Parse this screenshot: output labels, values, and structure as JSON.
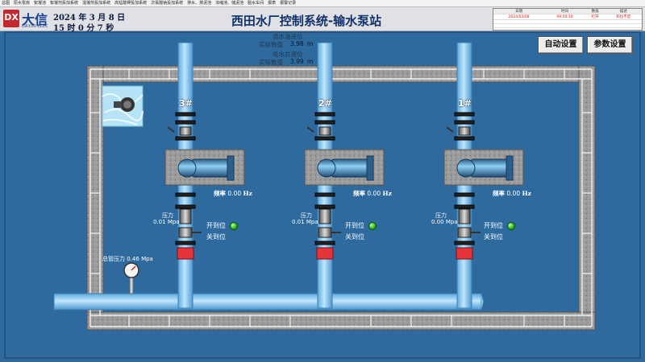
{
  "menu": [
    "总图",
    "原水泵房",
    "絮凝池",
    "絮凝剂投加系统",
    "混凝剂投加系统",
    "高锰酸钾投加系统",
    "次氯酸钠投加系统",
    "排水、排泥池",
    "浓缩池、储泥池",
    "脱水车间",
    "报表",
    "报警记录"
  ],
  "header": {
    "logo_mark": "DX",
    "logo_name": "大信",
    "logo_sub": "DAXIN-ELEC",
    "date_line": "2024 年  3  月  8  日",
    "time_line": "15  时  0  分 7  秒",
    "title": "西田水厂控制系统-输水泵站"
  },
  "alarm": {
    "headers": [
      "日期",
      "时间",
      "数值",
      "描述"
    ],
    "row": [
      "2024/03/08",
      "09:50:10",
      "打开",
      "料位不足"
    ]
  },
  "buttons": {
    "auto": "自动设置",
    "params": "参数设置"
  },
  "levels": {
    "clear_label": "清水池液位",
    "clear_value_label": "实际数值",
    "clear_value": "3.98",
    "clear_unit": "m",
    "suction_label": "吸水井液位",
    "suction_value_label": "实际数值",
    "suction_value": "3.99",
    "suction_unit": "m"
  },
  "pumps": [
    {
      "num": "3#",
      "freq_label": "频率",
      "freq": "0.00",
      "freq_unit": "Hz",
      "press_label": "压力",
      "press": "0.01",
      "press_unit": "Mpa",
      "open_label": "开到位",
      "close_label": "关到位"
    },
    {
      "num": "2#",
      "freq_label": "频率",
      "freq": "0.00",
      "freq_unit": "Hz",
      "press_label": "压力",
      "press": "0.01",
      "press_unit": "Mpa",
      "open_label": "开到位",
      "close_label": "关到位"
    },
    {
      "num": "1#",
      "freq_label": "频率",
      "freq": "0.00",
      "freq_unit": "Hz",
      "press_label": "压力",
      "press": "0.00",
      "press_unit": "Mpa",
      "open_label": "开到位",
      "close_label": "关到位"
    }
  ],
  "main_pressure": {
    "label": "总管压力",
    "value": "0.46",
    "unit": "Mpa"
  },
  "colors": {
    "background": "#2e6a9e",
    "pipe": "#7fc3ef",
    "lamp_on": "#2fbf1a",
    "title": "#12306a"
  }
}
